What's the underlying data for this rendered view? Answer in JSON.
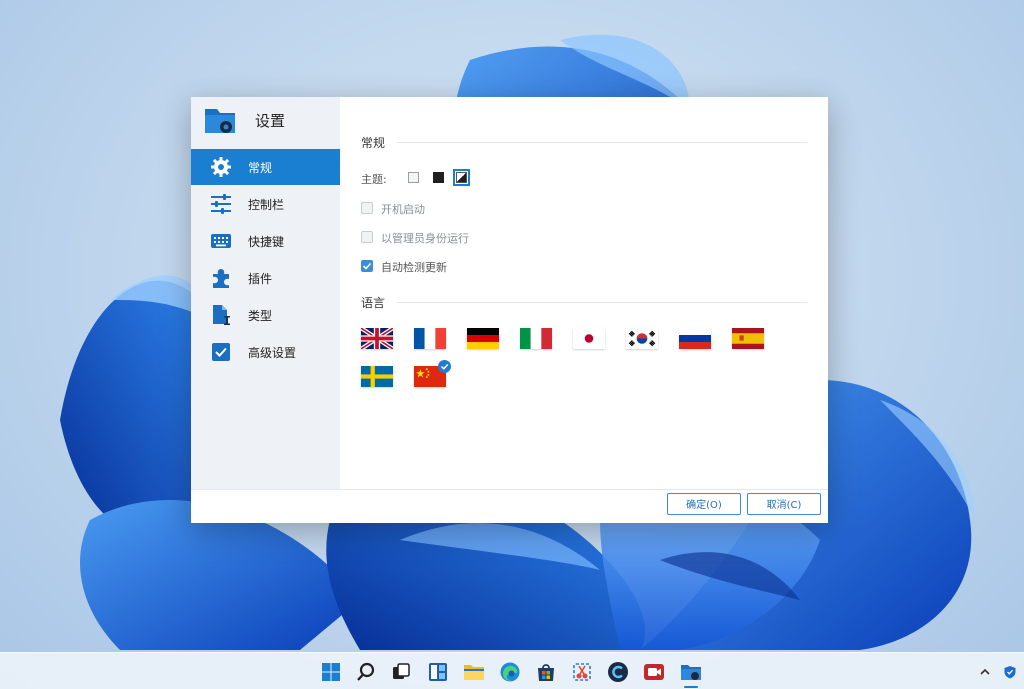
{
  "window": {
    "title": "设置"
  },
  "sidebar": {
    "items": [
      {
        "label": "常规",
        "icon": "gear-icon",
        "active": true
      },
      {
        "label": "控制栏",
        "icon": "sliders-icon",
        "active": false
      },
      {
        "label": "快捷键",
        "icon": "keyboard-icon",
        "active": false
      },
      {
        "label": "插件",
        "icon": "puzzle-icon",
        "active": false
      },
      {
        "label": "类型",
        "icon": "file-type-icon",
        "active": false
      },
      {
        "label": "高级设置",
        "icon": "checkbox-icon",
        "active": false
      }
    ]
  },
  "general": {
    "section_title": "常规",
    "theme_label": "主题:",
    "theme_options": [
      "light",
      "dark",
      "auto"
    ],
    "theme_selected": "auto",
    "options": [
      {
        "label": "开机启动",
        "checked": false
      },
      {
        "label": "以管理员身份运行",
        "checked": false
      },
      {
        "label": "自动检测更新",
        "checked": true
      }
    ]
  },
  "language": {
    "section_title": "语言",
    "flags": [
      "uk-flag",
      "france-flag",
      "germany-flag",
      "italy-flag",
      "japan-flag",
      "korea-flag",
      "russia-flag",
      "spain-flag",
      "sweden-flag",
      "china-flag"
    ],
    "selected": "china-flag"
  },
  "footer": {
    "ok_label": "确定(O)",
    "cancel_label": "取消(C)"
  },
  "colors": {
    "accent": "#1a7fd0",
    "sidebar_bg": "#eef1f5"
  },
  "taskbar": {
    "icons": [
      "windows-start-icon",
      "search-icon",
      "task-view-icon",
      "widgets-icon",
      "file-explorer-icon",
      "edge-icon",
      "store-icon",
      "snipping-tool-icon",
      "ccleaner-icon",
      "recorder-icon",
      "settings-app-icon"
    ],
    "active": "settings-app-icon",
    "tray": [
      "chevron-up-icon",
      "shield-icon"
    ]
  }
}
